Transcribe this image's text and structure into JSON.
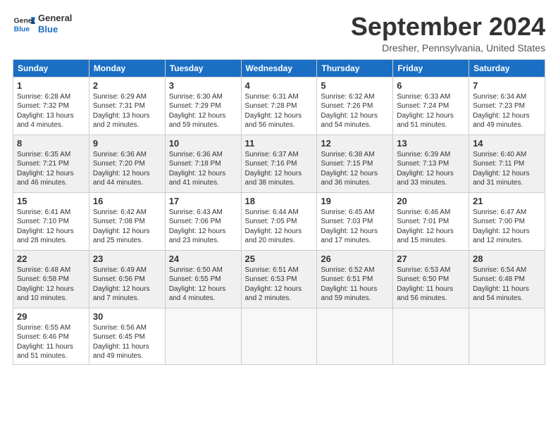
{
  "header": {
    "logo_line1": "General",
    "logo_line2": "Blue",
    "month": "September 2024",
    "location": "Dresher, Pennsylvania, United States"
  },
  "weekdays": [
    "Sunday",
    "Monday",
    "Tuesday",
    "Wednesday",
    "Thursday",
    "Friday",
    "Saturday"
  ],
  "weeks": [
    [
      {
        "day": 1,
        "info": "Sunrise: 6:28 AM\nSunset: 7:32 PM\nDaylight: 13 hours\nand 4 minutes."
      },
      {
        "day": 2,
        "info": "Sunrise: 6:29 AM\nSunset: 7:31 PM\nDaylight: 13 hours\nand 2 minutes."
      },
      {
        "day": 3,
        "info": "Sunrise: 6:30 AM\nSunset: 7:29 PM\nDaylight: 12 hours\nand 59 minutes."
      },
      {
        "day": 4,
        "info": "Sunrise: 6:31 AM\nSunset: 7:28 PM\nDaylight: 12 hours\nand 56 minutes."
      },
      {
        "day": 5,
        "info": "Sunrise: 6:32 AM\nSunset: 7:26 PM\nDaylight: 12 hours\nand 54 minutes."
      },
      {
        "day": 6,
        "info": "Sunrise: 6:33 AM\nSunset: 7:24 PM\nDaylight: 12 hours\nand 51 minutes."
      },
      {
        "day": 7,
        "info": "Sunrise: 6:34 AM\nSunset: 7:23 PM\nDaylight: 12 hours\nand 49 minutes."
      }
    ],
    [
      {
        "day": 8,
        "info": "Sunrise: 6:35 AM\nSunset: 7:21 PM\nDaylight: 12 hours\nand 46 minutes."
      },
      {
        "day": 9,
        "info": "Sunrise: 6:36 AM\nSunset: 7:20 PM\nDaylight: 12 hours\nand 44 minutes."
      },
      {
        "day": 10,
        "info": "Sunrise: 6:36 AM\nSunset: 7:18 PM\nDaylight: 12 hours\nand 41 minutes."
      },
      {
        "day": 11,
        "info": "Sunrise: 6:37 AM\nSunset: 7:16 PM\nDaylight: 12 hours\nand 38 minutes."
      },
      {
        "day": 12,
        "info": "Sunrise: 6:38 AM\nSunset: 7:15 PM\nDaylight: 12 hours\nand 36 minutes."
      },
      {
        "day": 13,
        "info": "Sunrise: 6:39 AM\nSunset: 7:13 PM\nDaylight: 12 hours\nand 33 minutes."
      },
      {
        "day": 14,
        "info": "Sunrise: 6:40 AM\nSunset: 7:11 PM\nDaylight: 12 hours\nand 31 minutes."
      }
    ],
    [
      {
        "day": 15,
        "info": "Sunrise: 6:41 AM\nSunset: 7:10 PM\nDaylight: 12 hours\nand 28 minutes."
      },
      {
        "day": 16,
        "info": "Sunrise: 6:42 AM\nSunset: 7:08 PM\nDaylight: 12 hours\nand 25 minutes."
      },
      {
        "day": 17,
        "info": "Sunrise: 6:43 AM\nSunset: 7:06 PM\nDaylight: 12 hours\nand 23 minutes."
      },
      {
        "day": 18,
        "info": "Sunrise: 6:44 AM\nSunset: 7:05 PM\nDaylight: 12 hours\nand 20 minutes."
      },
      {
        "day": 19,
        "info": "Sunrise: 6:45 AM\nSunset: 7:03 PM\nDaylight: 12 hours\nand 17 minutes."
      },
      {
        "day": 20,
        "info": "Sunrise: 6:46 AM\nSunset: 7:01 PM\nDaylight: 12 hours\nand 15 minutes."
      },
      {
        "day": 21,
        "info": "Sunrise: 6:47 AM\nSunset: 7:00 PM\nDaylight: 12 hours\nand 12 minutes."
      }
    ],
    [
      {
        "day": 22,
        "info": "Sunrise: 6:48 AM\nSunset: 6:58 PM\nDaylight: 12 hours\nand 10 minutes."
      },
      {
        "day": 23,
        "info": "Sunrise: 6:49 AM\nSunset: 6:56 PM\nDaylight: 12 hours\nand 7 minutes."
      },
      {
        "day": 24,
        "info": "Sunrise: 6:50 AM\nSunset: 6:55 PM\nDaylight: 12 hours\nand 4 minutes."
      },
      {
        "day": 25,
        "info": "Sunrise: 6:51 AM\nSunset: 6:53 PM\nDaylight: 12 hours\nand 2 minutes."
      },
      {
        "day": 26,
        "info": "Sunrise: 6:52 AM\nSunset: 6:51 PM\nDaylight: 11 hours\nand 59 minutes."
      },
      {
        "day": 27,
        "info": "Sunrise: 6:53 AM\nSunset: 6:50 PM\nDaylight: 11 hours\nand 56 minutes."
      },
      {
        "day": 28,
        "info": "Sunrise: 6:54 AM\nSunset: 6:48 PM\nDaylight: 11 hours\nand 54 minutes."
      }
    ],
    [
      {
        "day": 29,
        "info": "Sunrise: 6:55 AM\nSunset: 6:46 PM\nDaylight: 11 hours\nand 51 minutes."
      },
      {
        "day": 30,
        "info": "Sunrise: 6:56 AM\nSunset: 6:45 PM\nDaylight: 11 hours\nand 49 minutes."
      },
      null,
      null,
      null,
      null,
      null
    ]
  ]
}
